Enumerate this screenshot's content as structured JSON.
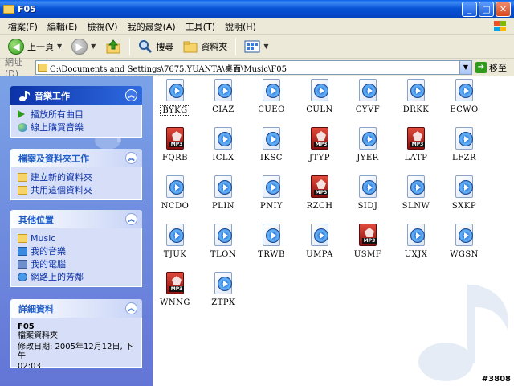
{
  "window": {
    "title": "F05"
  },
  "menu": [
    "檔案(F)",
    "編輯(E)",
    "檢視(V)",
    "我的最愛(A)",
    "工具(T)",
    "說明(H)"
  ],
  "toolbar": {
    "back_label": "上一頁",
    "search_label": "搜尋",
    "folders_label": "資料夾"
  },
  "address": {
    "label": "網址(D)",
    "path": "C:\\Documents and Settings\\7675.YUANTA\\桌面\\Music\\F05",
    "go_label": "移至"
  },
  "sidebar": {
    "music_tasks": {
      "title": "音樂工作",
      "items": [
        "播放所有曲目",
        "線上購買音樂"
      ]
    },
    "file_tasks": {
      "title": "檔案及資料夾工作",
      "items": [
        "建立新的資料夾",
        "共用這個資料夾"
      ]
    },
    "other_places": {
      "title": "其他位置",
      "items": [
        "Music",
        "我的音樂",
        "我的電腦",
        "網路上的芳鄰"
      ]
    },
    "details": {
      "title": "詳細資料",
      "name": "F05",
      "type": "檔案資料夾",
      "modified_label": "修改日期: 2005年12月12日, 下午",
      "modified_time": "02:03"
    }
  },
  "files": [
    {
      "name": "BYKG",
      "type": "wma",
      "selected": true
    },
    {
      "name": "CIAZ",
      "type": "wma"
    },
    {
      "name": "CUEO",
      "type": "wma"
    },
    {
      "name": "CULN",
      "type": "wma"
    },
    {
      "name": "CYVF",
      "type": "wma"
    },
    {
      "name": "DRKK",
      "type": "wma"
    },
    {
      "name": "ECWO",
      "type": "wma"
    },
    {
      "name": "FQRB",
      "type": "mp3"
    },
    {
      "name": "ICLX",
      "type": "wma"
    },
    {
      "name": "IKSC",
      "type": "wma"
    },
    {
      "name": "JTYP",
      "type": "mp3"
    },
    {
      "name": "JYER",
      "type": "wma"
    },
    {
      "name": "LATP",
      "type": "mp3"
    },
    {
      "name": "LFZR",
      "type": "wma"
    },
    {
      "name": "NCDO",
      "type": "wma"
    },
    {
      "name": "PLIN",
      "type": "wma"
    },
    {
      "name": "PNIY",
      "type": "wma"
    },
    {
      "name": "RZCH",
      "type": "mp3"
    },
    {
      "name": "SIDJ",
      "type": "wma"
    },
    {
      "name": "SLNW",
      "type": "wma"
    },
    {
      "name": "SXKP",
      "type": "wma"
    },
    {
      "name": "TJUK",
      "type": "wma"
    },
    {
      "name": "TLON",
      "type": "wma"
    },
    {
      "name": "TRWB",
      "type": "wma"
    },
    {
      "name": "UMPA",
      "type": "wma"
    },
    {
      "name": "USMF",
      "type": "mp3"
    },
    {
      "name": "UXJX",
      "type": "wma"
    },
    {
      "name": "WGSN",
      "type": "wma"
    },
    {
      "name": "WNNG",
      "type": "mp3"
    },
    {
      "name": "ZTPX",
      "type": "wma"
    }
  ],
  "mp3_badge": "MP3",
  "watermark": "#3808"
}
